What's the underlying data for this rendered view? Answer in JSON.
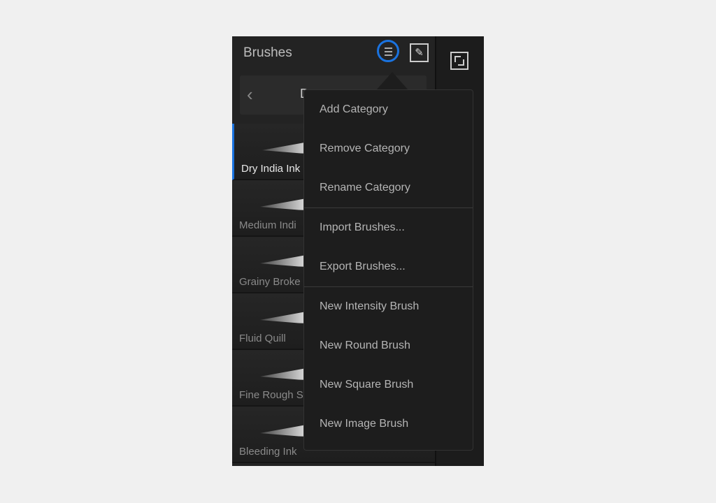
{
  "panel": {
    "title": "Brushes",
    "menu_icon": "hamburger-icon",
    "pin_icon": "pin-icon",
    "expand_icon": "expand-icon",
    "accent": "#1a73e0"
  },
  "category": {
    "prev_icon": "chevron-left-icon",
    "prev": "‹",
    "name": "D"
  },
  "brushes": [
    {
      "label": "Dry India Ink",
      "selected": true
    },
    {
      "label": "Medium Indi"
    },
    {
      "label": "Grainy Broke"
    },
    {
      "label": "Fluid Quill"
    },
    {
      "label": "Fine Rough S"
    },
    {
      "label": "Bleeding Ink"
    }
  ],
  "menu": {
    "groups": [
      [
        "Add Category",
        "Remove Category",
        "Rename Category"
      ],
      [
        "Import Brushes...",
        "Export Brushes..."
      ],
      [
        "New Intensity Brush",
        "New Round Brush",
        "New Square Brush",
        "New Image Brush"
      ]
    ]
  }
}
